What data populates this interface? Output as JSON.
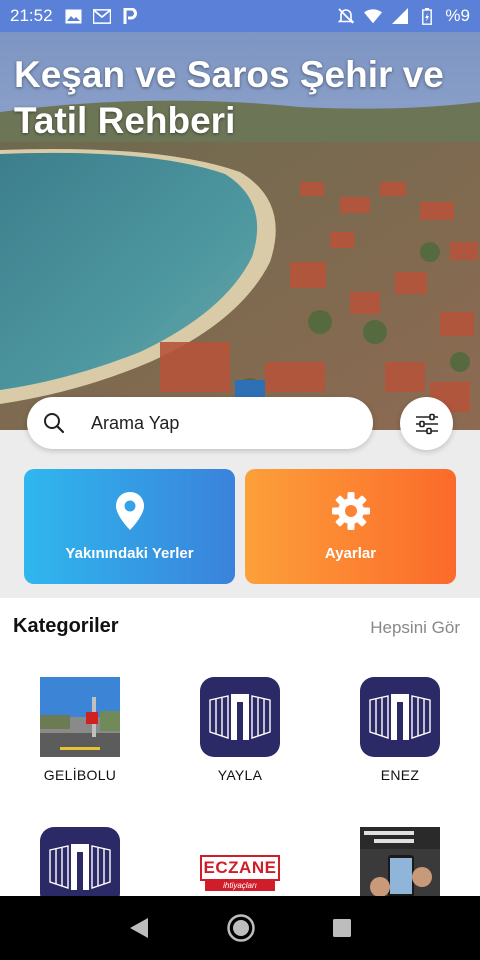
{
  "status_bar": {
    "time": "21:52",
    "battery": "%9",
    "left_icons": [
      "image-icon",
      "gmail-icon",
      "parking-icon"
    ],
    "right_icons": [
      "mute-icon",
      "wifi-icon",
      "signal-icon",
      "battery-icon"
    ]
  },
  "hero": {
    "title": "Keşan ve Saros Şehir ve Tatil Rehberi"
  },
  "search": {
    "placeholder": "Arama Yap"
  },
  "actions": {
    "nearby_label": "Yakınındaki Yerler",
    "settings_label": "Ayarlar"
  },
  "categories": {
    "title": "Kategoriler",
    "see_all": "Hepsini Gör",
    "items": [
      {
        "label": "GELİBOLU",
        "icon": "photo"
      },
      {
        "label": "YAYLA",
        "icon": "building-icon"
      },
      {
        "label": "ENEZ",
        "icon": "building-icon"
      },
      {
        "label": "",
        "icon": "building-icon"
      },
      {
        "label": "",
        "icon": "pharmacy-logo"
      },
      {
        "label": "",
        "icon": "photo"
      }
    ],
    "pharmacy_logo_text": "ECZANE",
    "pharmacy_logo_sub": "ihtiyaçları"
  },
  "colors": {
    "status_bar": "#5a80d8",
    "nearby_card": "#3a82db",
    "settings_card": "#fb6a2a",
    "category_icon_bg": "#2b2a66"
  }
}
